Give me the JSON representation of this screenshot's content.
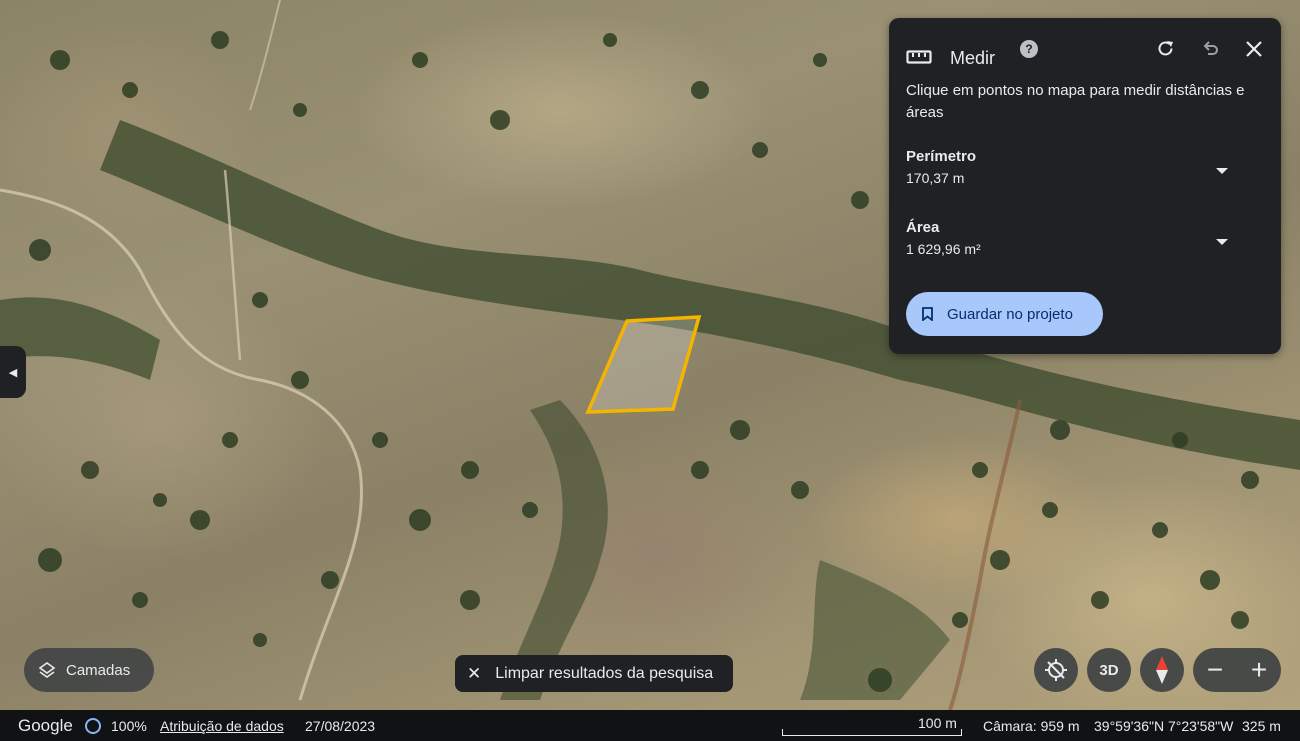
{
  "panel": {
    "title": "Medir",
    "help_icon": "?",
    "description": "Clique em pontos no mapa para medir distâncias e áreas",
    "perimeter_label": "Perímetro",
    "perimeter_value": "170,37 m",
    "area_label": "Área",
    "area_value": "1 629,96 m²",
    "save_label": "Guardar no projeto",
    "icons": [
      "ruler-icon",
      "help-icon",
      "redo-icon",
      "undo-icon",
      "close-icon",
      "bookmark-icon"
    ]
  },
  "map": {
    "layers_label": "Camadas",
    "clear_label": "Limpar resultados da pesquisa",
    "three_d_label": "3D",
    "zoom_out_label": "−",
    "zoom_in_label": "+",
    "measure_color": "#f4b400"
  },
  "status": {
    "logo": "Google",
    "percent": "100%",
    "attribution": "Atribuição de dados",
    "date": "27/08/2023",
    "scale": "100 m",
    "camera": "Câmara: 959 m",
    "coords": "39°59'36\"N 7°23'58\"W",
    "altitude": "325 m"
  },
  "colors": {
    "panel_bg": "#202124",
    "save_btn_bg": "#a8c7fa",
    "status_bg": "#111214"
  }
}
